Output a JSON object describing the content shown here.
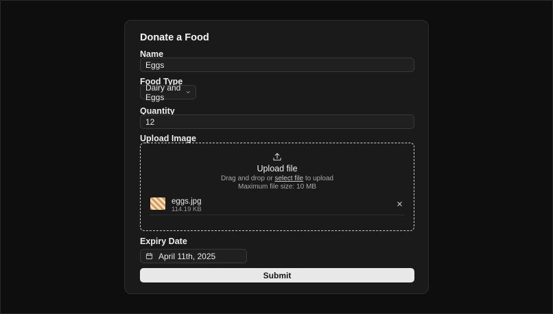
{
  "form": {
    "title": "Donate a Food",
    "name": {
      "label": "Name",
      "value": "Eggs"
    },
    "food_type": {
      "label": "Food Type",
      "selected": "Dairy and Eggs"
    },
    "quantity": {
      "label": "Quantity",
      "value": "12"
    },
    "upload": {
      "label": "Upload Image",
      "title": "Upload file",
      "hint_before": "Drag and drop or ",
      "hint_link": "select file",
      "hint_after": " to upload",
      "max_size": "Maximum file size: 10 MB",
      "file": {
        "name": "eggs.jpg",
        "size": "114.19 KB"
      }
    },
    "expiry": {
      "label": "Expiry Date",
      "value": "April 11th, 2025"
    },
    "submit_label": "Submit"
  },
  "icons": {
    "upload": "upload-icon",
    "chevron": "chevron-down-icon",
    "close": "close-icon",
    "calendar": "calendar-icon"
  },
  "colors": {
    "background": "#0e0e0e",
    "card": "#1a1a1a",
    "submit_bg": "#e8e8e8"
  }
}
